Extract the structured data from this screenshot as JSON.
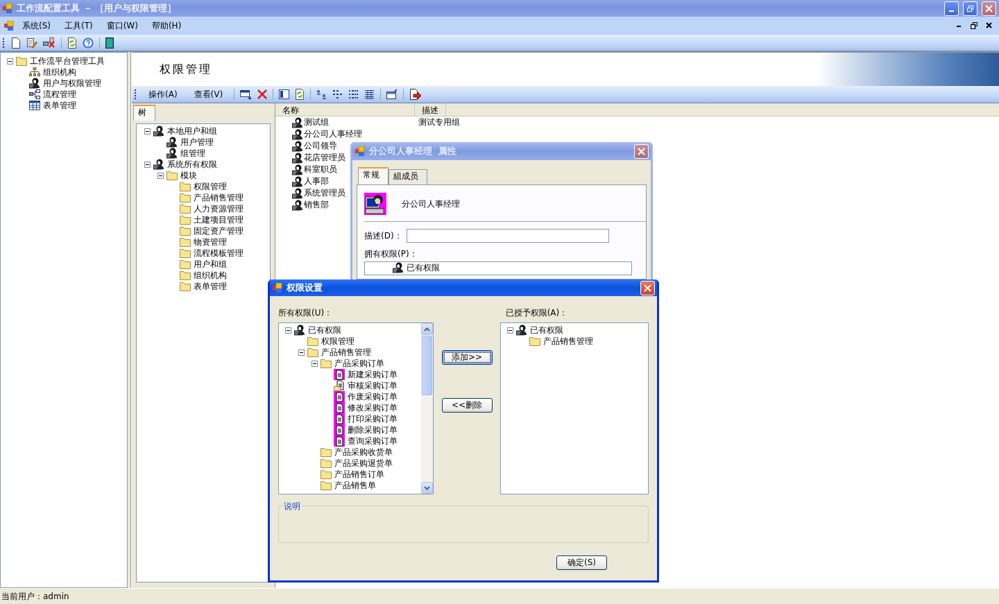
{
  "window": {
    "title": "工作流配置工具 － ［用户与权限管理］"
  },
  "menu": [
    "系统(S)",
    "工具(T)",
    "窗口(W)",
    "帮助(H)"
  ],
  "nav_tree": [
    {
      "label": "工作流平台管理工具",
      "kind": "folder",
      "expanded": true,
      "children": [
        {
          "label": "组织机构",
          "kind": "org"
        },
        {
          "label": "用户与权限管理",
          "kind": "user"
        },
        {
          "label": "流程管理",
          "kind": "flow"
        },
        {
          "label": "表单管理",
          "kind": "form"
        }
      ]
    }
  ],
  "page": {
    "title": "权限管理",
    "menu": [
      "操作(A)",
      "查看(V)"
    ],
    "tabs": [
      {
        "label": "树",
        "selected": true
      }
    ],
    "tree": [
      {
        "label": "本地用户和组",
        "kind": "user",
        "expanded": true,
        "children": [
          {
            "label": "用户管理",
            "kind": "user"
          },
          {
            "label": "组管理",
            "kind": "user"
          }
        ]
      },
      {
        "label": "系统所有权限",
        "kind": "user",
        "expanded": true,
        "children": [
          {
            "label": "模块",
            "kind": "folder",
            "expanded": true,
            "children": [
              {
                "label": "权限管理",
                "kind": "folder"
              },
              {
                "label": "产品销售管理",
                "kind": "folder"
              },
              {
                "label": "人力资源管理",
                "kind": "folder"
              },
              {
                "label": "土建项目管理",
                "kind": "folder"
              },
              {
                "label": "固定资产管理",
                "kind": "folder"
              },
              {
                "label": "物资管理",
                "kind": "folder"
              },
              {
                "label": "流程模板管理",
                "kind": "folder"
              },
              {
                "label": "用户和组",
                "kind": "folder"
              },
              {
                "label": "组织机构",
                "kind": "folder"
              },
              {
                "label": "表单管理",
                "kind": "folder"
              }
            ]
          }
        ]
      }
    ],
    "list": {
      "columns": [
        "名称",
        "描述"
      ],
      "rows": [
        {
          "name": "测试组",
          "description": "测试专用组"
        },
        {
          "name": "分公司人事经理"
        },
        {
          "name": "公司领导"
        },
        {
          "name": "花店管理员"
        },
        {
          "name": "科室职员"
        },
        {
          "name": "人事部"
        },
        {
          "name": "系统管理员"
        },
        {
          "name": "销售部"
        }
      ]
    }
  },
  "properties_dialog": {
    "title": "分公司人事经理  属性",
    "tabs": [
      {
        "label": "常规",
        "selected": true
      },
      {
        "label": "組成员",
        "selected": false
      }
    ],
    "name": "分公司人事经理",
    "description_label": "描述(D)：",
    "permissions_label": "拥有权限(P)：",
    "tree": [
      {
        "label": "已有权限",
        "kind": "user"
      }
    ]
  },
  "permission_dialog": {
    "title": "权限设置",
    "all_label": "所有权限(U)：",
    "granted_label": "已授予权限(A)：",
    "all_tree": [
      {
        "label": "已有权限",
        "kind": "user",
        "expanded": true,
        "children": [
          {
            "label": "权限管理",
            "kind": "folder"
          },
          {
            "label": "产品销售管理",
            "kind": "folder",
            "expanded": true,
            "children": [
              {
                "label": "产品采购订单",
                "kind": "folder",
                "expanded": true,
                "children": [
                  {
                    "label": "新建采购订单",
                    "kind": "doc"
                  },
                  {
                    "label": "审核采购订单",
                    "kind": "doc-folder"
                  },
                  {
                    "label": "作废采购订单",
                    "kind": "doc"
                  },
                  {
                    "label": "修改采购订单",
                    "kind": "doc"
                  },
                  {
                    "label": "打印采购订单",
                    "kind": "doc"
                  },
                  {
                    "label": "删除采购订单",
                    "kind": "doc"
                  },
                  {
                    "label": "查询采购订单",
                    "kind": "doc"
                  }
                ]
              },
              {
                "label": "产品采购收货单",
                "kind": "folder"
              },
              {
                "label": "产品采购退货单",
                "kind": "folder"
              },
              {
                "label": "产品销售订单",
                "kind": "folder"
              },
              {
                "label": "产品销售单",
                "kind": "folder"
              }
            ]
          }
        ]
      }
    ],
    "buttons": [
      {
        "label": "添加>>",
        "focused": true
      },
      {
        "label": "<<删除",
        "focused": false
      }
    ],
    "granted_tree": [
      {
        "label": "已有权限",
        "kind": "user",
        "expanded": true,
        "children": [
          {
            "label": "产品销售管理",
            "kind": "folder"
          }
        ]
      }
    ],
    "note_label": "说明",
    "ok_button": "确定(S)"
  },
  "status_bar": "当前用户：admin"
}
